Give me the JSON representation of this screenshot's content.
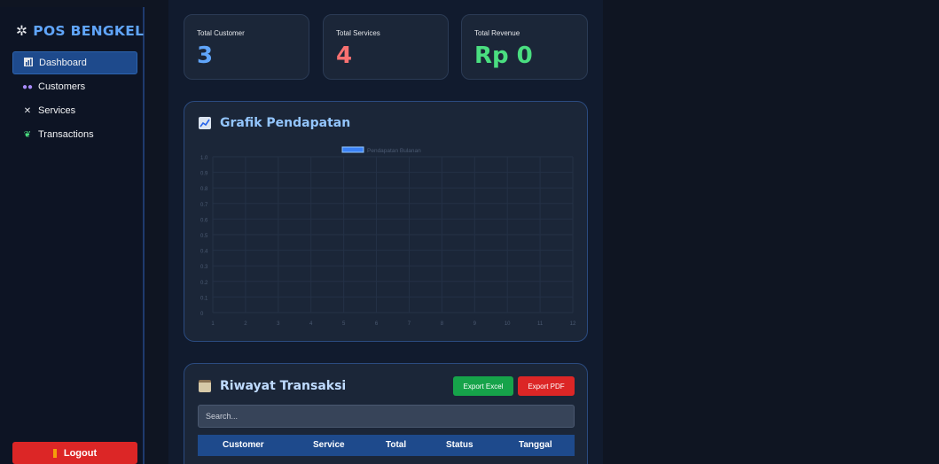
{
  "sidebar": {
    "brand": "POS BENGKEL",
    "brand_icon": "gear-icon",
    "items": [
      {
        "label": "Dashboard",
        "icon": "bar-chart-icon",
        "active": true
      },
      {
        "label": "Customers",
        "icon": "users-icon",
        "active": false
      },
      {
        "label": "Services",
        "icon": "tools-icon",
        "active": false
      },
      {
        "label": "Transactions",
        "icon": "money-icon",
        "active": false
      }
    ],
    "logout_label": "Logout"
  },
  "stats": [
    {
      "label": "Total Customer",
      "value": "3",
      "color": "#60a5fa"
    },
    {
      "label": "Total Services",
      "value": "4",
      "color": "#f87171"
    },
    {
      "label": "Total Revenue",
      "value": "Rp 0",
      "color": "#4ade80"
    }
  ],
  "chart_card": {
    "title": "Grafik Pendapatan",
    "title_icon": "chart-icon"
  },
  "chart_data": {
    "type": "bar",
    "x": [
      1,
      2,
      3,
      4,
      5,
      6,
      7,
      8,
      9,
      10,
      11,
      12
    ],
    "series": [
      {
        "name": "Pendapatan Bulanan",
        "values": [
          0,
          0,
          0,
          0,
          0,
          0,
          0,
          0,
          0,
          0,
          0,
          0
        ],
        "color": "#3b82f6"
      }
    ],
    "yticks": [
      "0",
      "0.1",
      "0.2",
      "0.3",
      "0.4",
      "0.5",
      "0.6",
      "0.7",
      "0.8",
      "0.9",
      "1.0"
    ],
    "xticks": [
      "1",
      "2",
      "3",
      "4",
      "5",
      "6",
      "7",
      "8",
      "9",
      "10",
      "11",
      "12"
    ],
    "ylim": [
      0,
      1
    ],
    "grid": true,
    "legend": "top"
  },
  "table_card": {
    "title": "Riwayat Transaksi",
    "title_icon": "clipboard-icon",
    "export_excel": "Export Excel",
    "export_pdf": "Export PDF",
    "search_placeholder": "Search...",
    "columns": [
      "Customer",
      "Service",
      "Total",
      "Status",
      "Tanggal"
    ]
  },
  "colors": {
    "accent": "#60a5fa",
    "nav_active": "#1e4a8c",
    "excel": "#16a34a",
    "pdf": "#dc2626"
  }
}
